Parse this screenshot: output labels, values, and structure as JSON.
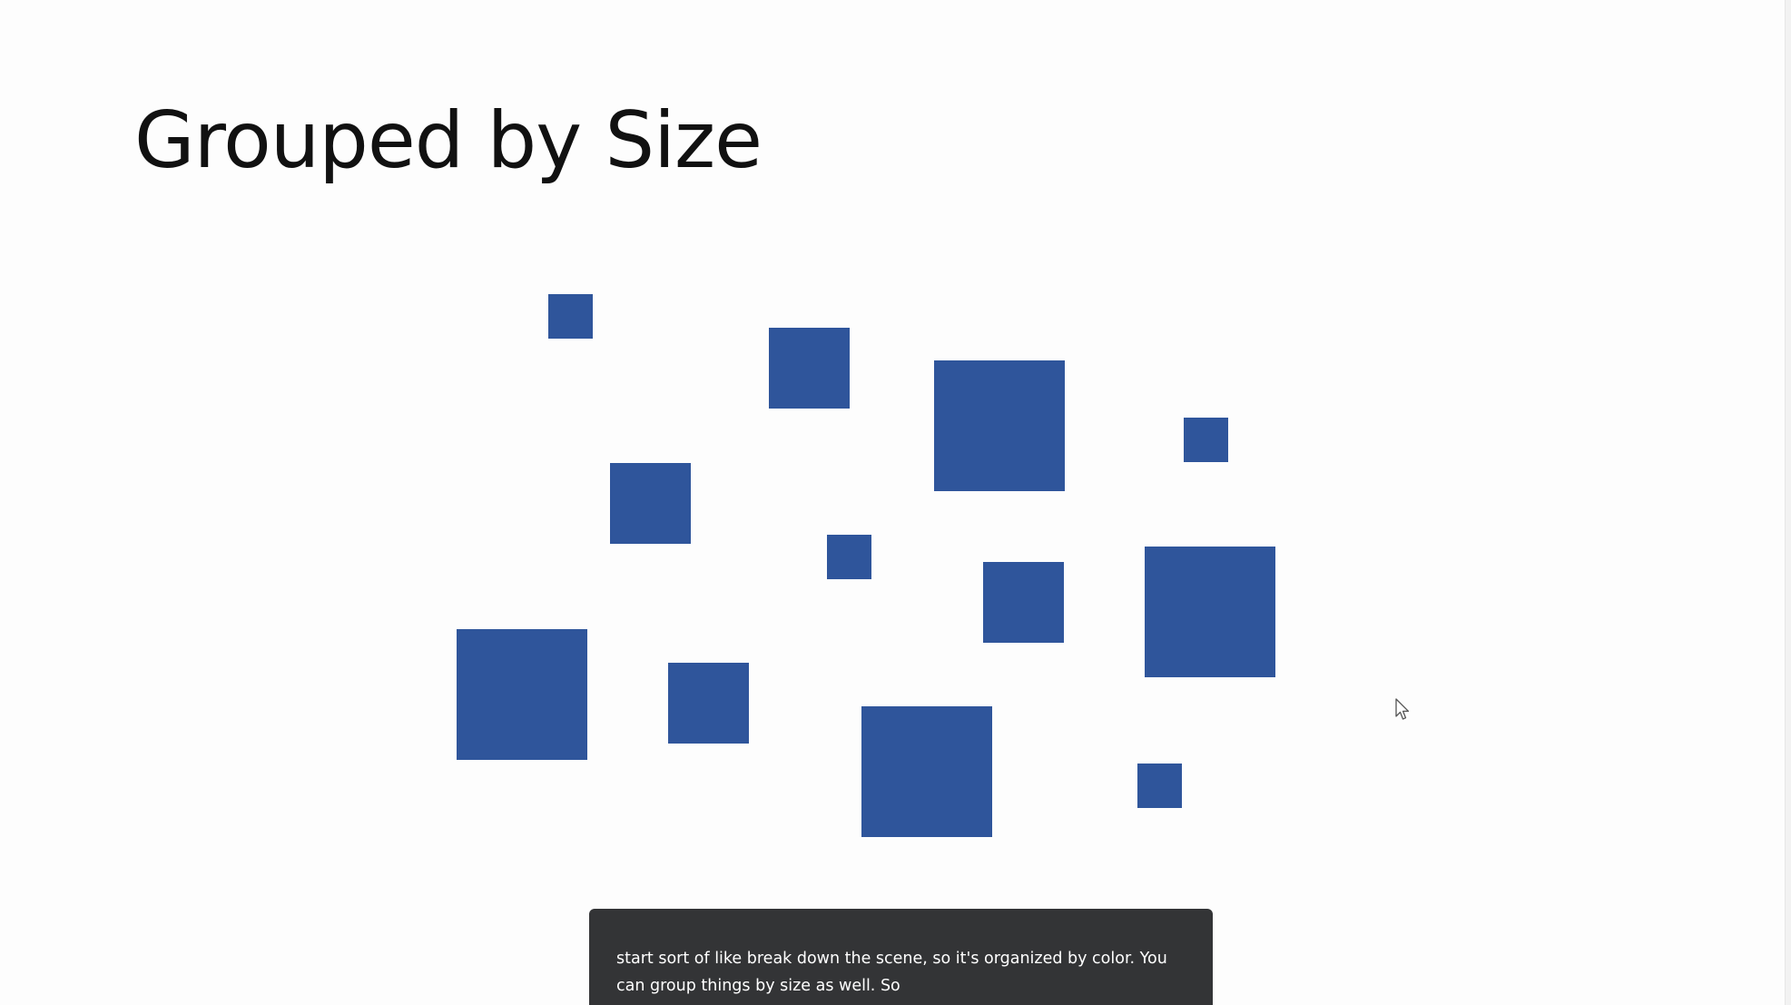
{
  "slide": {
    "title": "Grouped by Size",
    "square_color": "#2f559b",
    "squares": [
      {
        "size": "small"
      },
      {
        "size": "medium"
      },
      {
        "size": "large"
      },
      {
        "size": "small"
      },
      {
        "size": "medium"
      },
      {
        "size": "small"
      },
      {
        "size": "medium"
      },
      {
        "size": "large"
      },
      {
        "size": "large"
      },
      {
        "size": "medium"
      },
      {
        "size": "large"
      },
      {
        "size": "small"
      }
    ]
  },
  "caption": {
    "lines": [
      "start sort of like break down the scene, so it's organized by color. You",
      "can group things by size as well. So"
    ]
  },
  "cursor": {
    "icon": "mouse-pointer-icon"
  }
}
